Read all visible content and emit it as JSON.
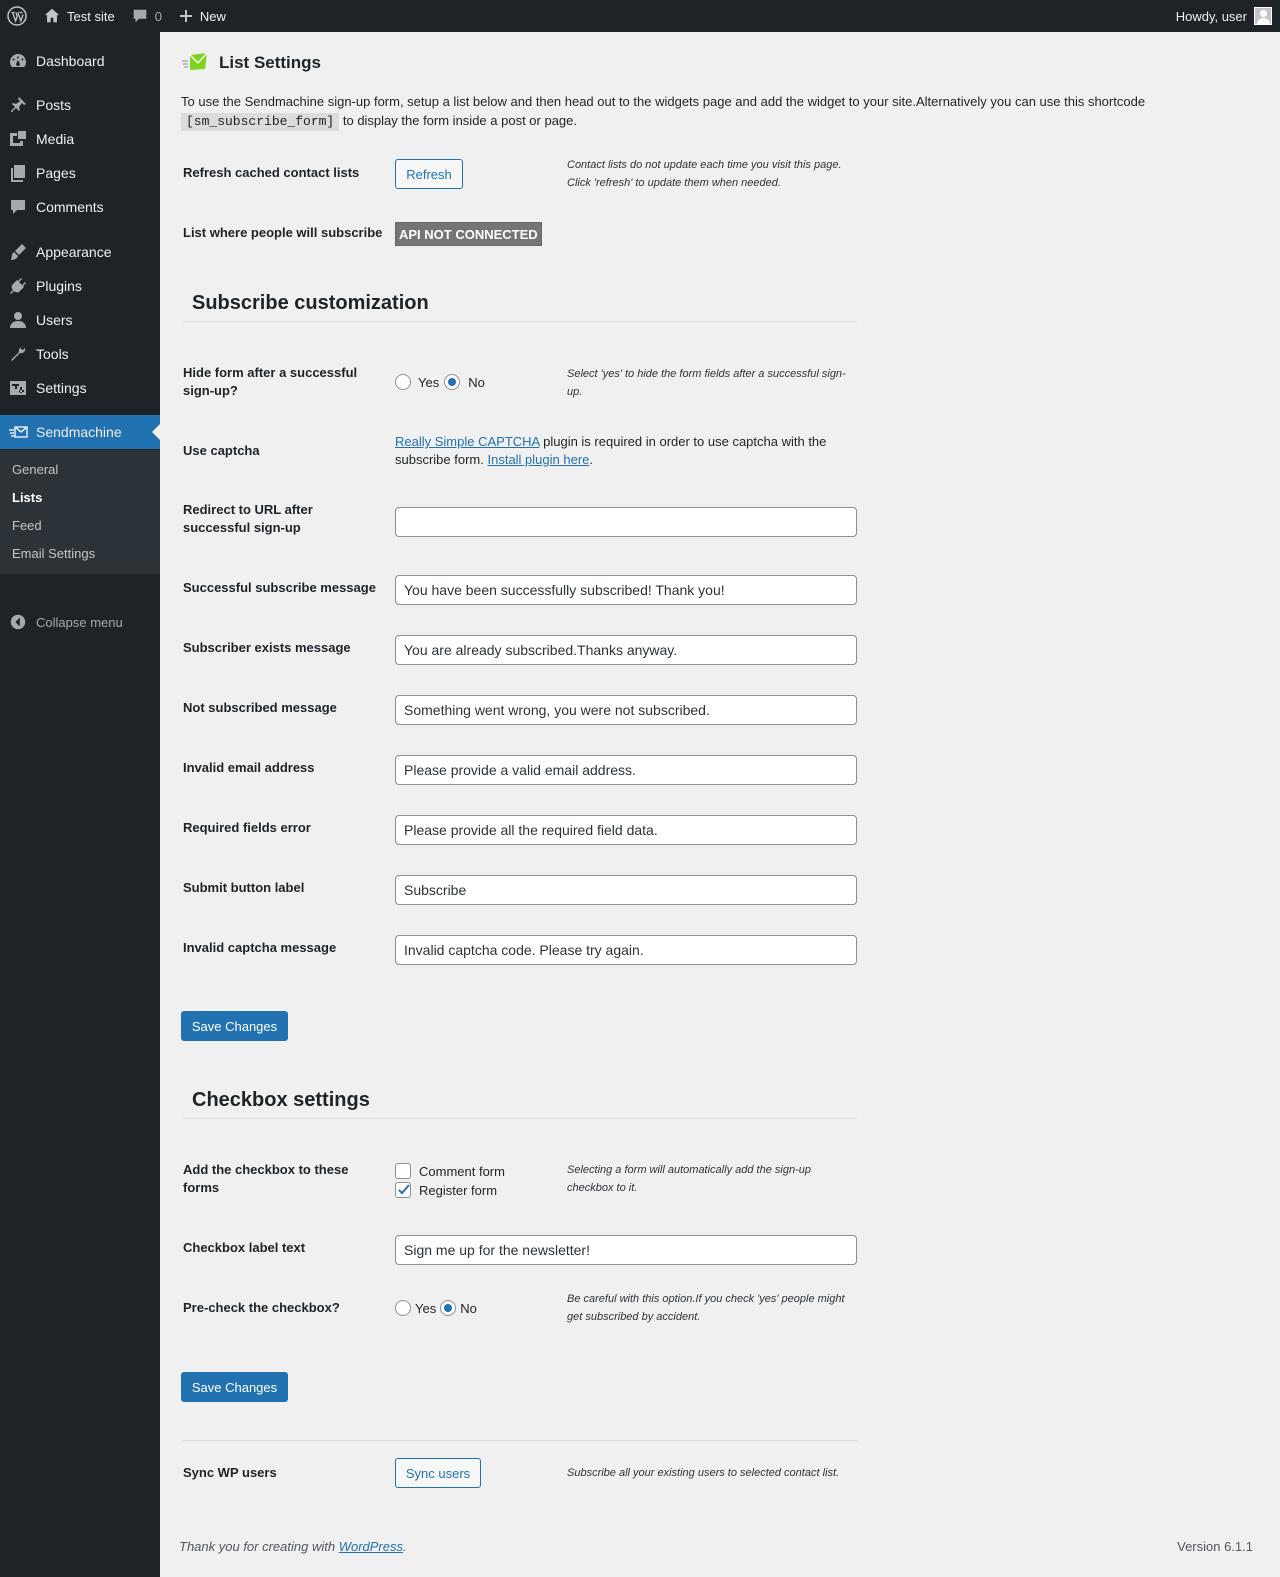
{
  "adminbar": {
    "site_name": "Test site",
    "comments_count": "0",
    "new_label": "New",
    "howdy": "Howdy, user"
  },
  "sidebar": {
    "items": [
      {
        "label": "Dashboard",
        "icon": "dashboard-icon"
      },
      {
        "label": "Posts",
        "icon": "pin-icon"
      },
      {
        "label": "Media",
        "icon": "media-icon"
      },
      {
        "label": "Pages",
        "icon": "pages-icon"
      },
      {
        "label": "Comments",
        "icon": "comment-icon"
      },
      {
        "label": "Appearance",
        "icon": "brush-icon"
      },
      {
        "label": "Plugins",
        "icon": "plugin-icon"
      },
      {
        "label": "Users",
        "icon": "user-icon"
      },
      {
        "label": "Tools",
        "icon": "wrench-icon"
      },
      {
        "label": "Settings",
        "icon": "settings-icon"
      },
      {
        "label": "Sendmachine",
        "icon": "sendmachine-icon"
      }
    ],
    "submenu": [
      "General",
      "Lists",
      "Feed",
      "Email Settings"
    ],
    "collapse": "Collapse menu"
  },
  "page": {
    "title": "List Settings",
    "intro_before": "To use the Sendmachine sign-up form, setup a list below and then head out to the widgets page and add the widget to your site.Alternatively you can use this shortcode",
    "shortcode": "[sm_subscribe_form]",
    "intro_after": "to display the form inside a post or page."
  },
  "lists": {
    "refresh_label": "Refresh cached contact lists",
    "refresh_button": "Refresh",
    "refresh_help": "Contact lists do not update each time you visit this page. Click 'refresh' to update them when needed.",
    "subscribe_list_label": "List where people will subscribe",
    "api_status": "API NOT CONNECTED"
  },
  "subscribe": {
    "heading": "Subscribe customization",
    "hide_form_label": "Hide form after a successful sign-up?",
    "yes": "Yes",
    "no": "No",
    "hide_form_help": "Select 'yes' to hide the form fields after a successful sign-up.",
    "captcha_label": "Use captcha",
    "captcha_link": "Really Simple CAPTCHA",
    "captcha_text": " plugin is required in order to use captcha with the subscribe form. ",
    "install_link": "Install plugin here",
    "captcha_period": ".",
    "redirect_label": "Redirect to URL after successful sign-up",
    "redirect_value": "",
    "success_label": "Successful subscribe message",
    "success_value": "You have been successfully subscribed! Thank you!",
    "exists_label": "Subscriber exists message",
    "exists_value": "You are already subscribed.Thanks anyway.",
    "not_subscribed_label": "Not subscribed message",
    "not_subscribed_value": "Something went wrong, you were not subscribed.",
    "invalid_email_label": "Invalid email address",
    "invalid_email_value": "Please provide a valid email address.",
    "required_label": "Required fields error",
    "required_value": "Please provide all the required field data.",
    "submit_label": "Submit button label",
    "submit_value": "Subscribe",
    "invalid_captcha_label": "Invalid captcha message",
    "invalid_captcha_value": "Invalid captcha code. Please try again.",
    "save": "Save Changes"
  },
  "checkbox": {
    "heading": "Checkbox settings",
    "add_label": "Add the checkbox to these forms",
    "comment_form": "Comment form",
    "register_form": "Register form",
    "add_help": "Selecting a form will automatically add the sign-up checkbox to it.",
    "label_text_label": "Checkbox label text",
    "label_text_value": "Sign me up for the newsletter!",
    "precheck_label": "Pre-check the checkbox?",
    "yes": "Yes",
    "no": "No",
    "precheck_help": "Be careful with this option.If you check 'yes' people might get subscribed by accident.",
    "save": "Save Changes"
  },
  "sync": {
    "label": "Sync WP users",
    "button": "Sync users",
    "help": "Subscribe all your existing users to selected contact list."
  },
  "footer": {
    "thanks_before": "Thank you for creating with ",
    "wp_link": "WordPress",
    "thanks_after": ".",
    "version": "Version 6.1.1"
  },
  "colors": {
    "admin_bg": "#1d2327",
    "accent": "#2271b1",
    "page_bg": "#f0f0f1"
  }
}
